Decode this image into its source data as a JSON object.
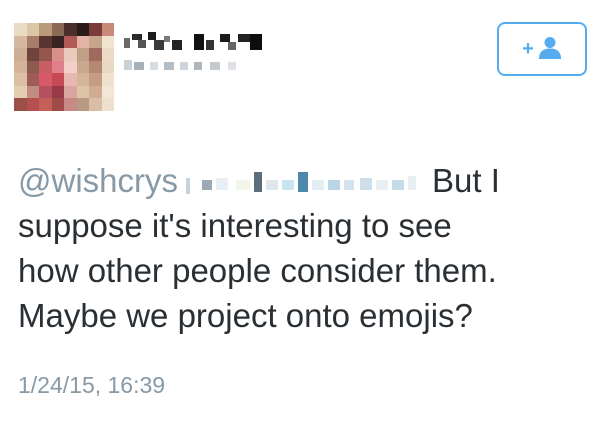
{
  "tweet": {
    "reply_to": "@wishcrys",
    "text_lines": [
      "But I",
      "suppose it's interesting to see",
      "how other people consider them.",
      "Maybe we project onto emojis?"
    ],
    "timestamp": "1/24/15, 16:39"
  },
  "colors": {
    "accent": "#55acee",
    "text": "#292f33",
    "muted": "#8899a6"
  },
  "icons": {
    "follow": "add-user-icon"
  }
}
